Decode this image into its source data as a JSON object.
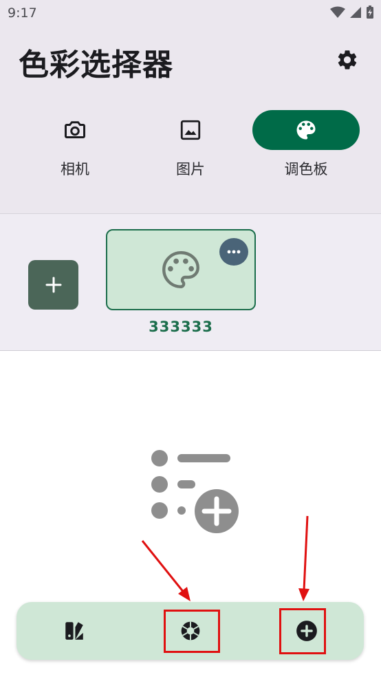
{
  "status_bar": {
    "time": "9:17"
  },
  "header": {
    "title": "色彩选择器"
  },
  "tabs": [
    {
      "label": "相机",
      "icon": "camera-icon"
    },
    {
      "label": "图片",
      "icon": "image-icon"
    },
    {
      "label": "调色板",
      "icon": "palette-icon",
      "active": true
    }
  ],
  "palette": {
    "swatches": [
      {
        "label": "333333",
        "icon": "palette-icon"
      }
    ]
  },
  "bottom_bar": {
    "buttons": [
      {
        "icon": "swatches-icon"
      },
      {
        "icon": "color-wheel-icon"
      },
      {
        "icon": "add-circle-icon"
      }
    ]
  },
  "colors": {
    "accent": "#006b48",
    "surface": "#ebe7ee",
    "swatch_bg": "#cfe7d6",
    "add_button": "#4b6658",
    "menu_button": "#4a6478",
    "highlight": "#e01010"
  }
}
